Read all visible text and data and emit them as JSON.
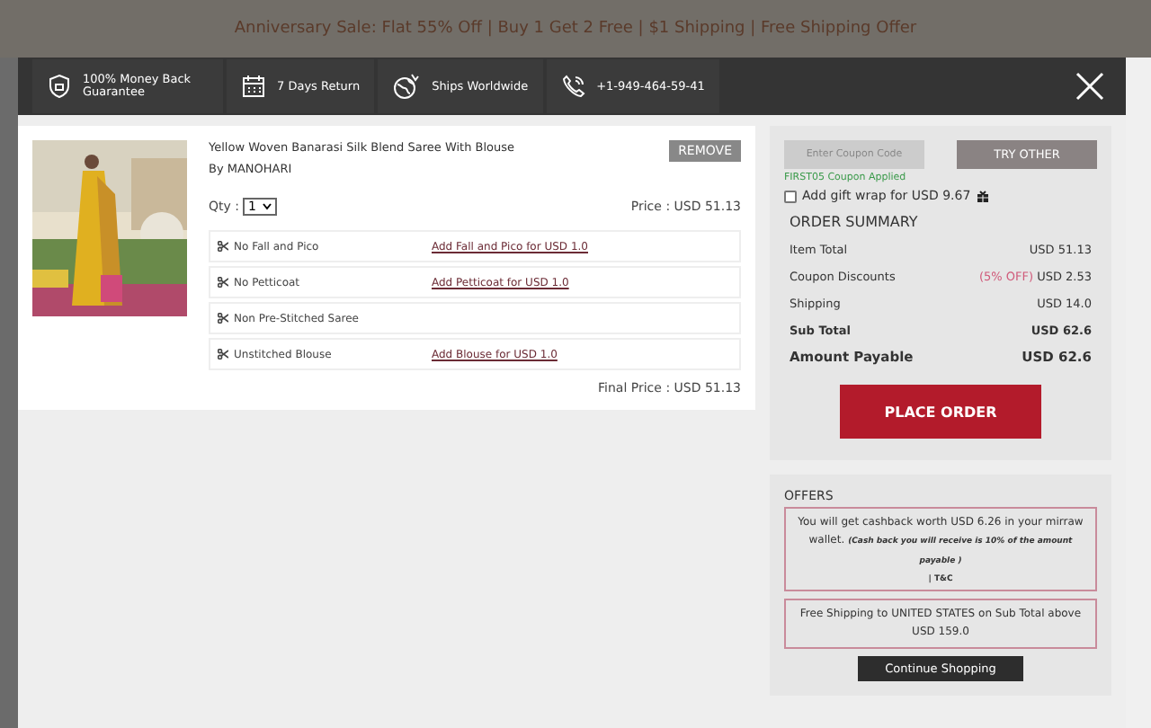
{
  "background_banner": {
    "text": "Anniversary Sale: Flat 55% Off | Buy 1 Get 2 Free | $1 Shipping | Free Shipping Offer"
  },
  "header": {
    "features": [
      {
        "kind": "shield",
        "label": "100% Money Back Guarantee"
      },
      {
        "kind": "calendar",
        "label": "7 Days Return"
      },
      {
        "kind": "globe",
        "label": "Ships Worldwide"
      },
      {
        "kind": "phone",
        "label": "+1-949-464-59-41"
      }
    ]
  },
  "item": {
    "title": "Yellow Woven Banarasi Silk Blend Saree With Blouse",
    "brand": "By MANOHARI",
    "remove_button": "REMOVE",
    "qty_label": "Qty :",
    "qty": "1",
    "price": "Price : USD 51.13",
    "addons": [
      {
        "label": "No Fall and Pico",
        "link": "Add Fall and Pico for USD 1.0"
      },
      {
        "label": "No Petticoat",
        "link": "Add Petticoat for USD 1.0"
      },
      {
        "label": "Non Pre-Stitched Saree"
      },
      {
        "label": "Unstitched Blouse",
        "link": "Add Blouse for USD 1.0"
      }
    ],
    "final_price": "Final Price : USD 51.13"
  },
  "coupon": {
    "placeholder": "Enter Coupon Code",
    "button": "TRY OTHER",
    "status": "FIRST05 Coupon Applied"
  },
  "gift_wrap": {
    "label": "Add gift wrap for USD 9.67",
    "checked": false
  },
  "summary": {
    "title": "ORDER SUMMARY",
    "rows": [
      {
        "label": "Item Total",
        "value": "USD 51.13",
        "kind": "normal"
      },
      {
        "label": "Coupon Discounts",
        "note": "(5% OFF)",
        "value": "USD 2.53",
        "kind": "normal"
      },
      {
        "label": "Shipping",
        "value": "USD 14.0",
        "kind": "normal"
      },
      {
        "label": "Sub Total",
        "value": "USD 62.6",
        "kind": "bold"
      },
      {
        "label": "Amount Payable",
        "value": "USD 62.6",
        "kind": "large"
      }
    ],
    "place_order": "PLACE ORDER"
  },
  "offers": {
    "title": "OFFERS",
    "cashback": {
      "text": "You will get cashback worth USD 6.26 in your mirraw wallet.",
      "note": "(Cash back you will receive is 10% of the amount payable )",
      "terms": "| T&C"
    },
    "shipping": "Free Shipping to UNITED STATES on Sub Total above USD 159.0",
    "continue_button": "Continue Shopping"
  }
}
